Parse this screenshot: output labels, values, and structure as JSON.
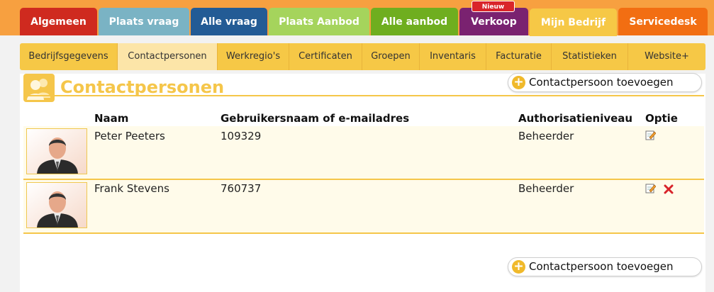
{
  "main_nav": {
    "tabs": [
      {
        "label": "Algemeen",
        "color": "#cf2a1f"
      },
      {
        "label": "Plaats vraag",
        "color": "#7ab3c4"
      },
      {
        "label": "Alle vraag",
        "color": "#235b95"
      },
      {
        "label": "Plaats Aanbod",
        "color": "#a5d45c"
      },
      {
        "label": "Alle aanbod",
        "color": "#6fae1f"
      },
      {
        "label": "Verkoop",
        "color": "#7a2270"
      },
      {
        "label": "Mijn Bedrijf",
        "color": "#f6c846"
      },
      {
        "label": "Servicedesk",
        "color": "#f26e12"
      }
    ],
    "new_badge": "Nieuw"
  },
  "sub_nav": {
    "tabs": [
      {
        "label": "Bedrijfsgegevens"
      },
      {
        "label": "Contactpersonen",
        "active": true
      },
      {
        "label": "Werkregio's"
      },
      {
        "label": "Certificaten"
      },
      {
        "label": "Groepen"
      },
      {
        "label": "Inventaris"
      },
      {
        "label": "Facturatie"
      },
      {
        "label": "Statistieken"
      },
      {
        "label": "Website+"
      }
    ]
  },
  "page": {
    "title": "Contactpersonen",
    "add_button_label": "Contactpersoon toevoegen"
  },
  "table": {
    "headers": {
      "name": "Naam",
      "username": "Gebruikersnaam of e-mailadres",
      "role": "Authorisatieniveau",
      "option": "Optie"
    },
    "rows": [
      {
        "name": "Peter Peeters",
        "username": "109329",
        "role": "Beheerder"
      },
      {
        "name": "Frank Stevens",
        "username": "760737",
        "role": "Beheerder"
      }
    ]
  }
}
